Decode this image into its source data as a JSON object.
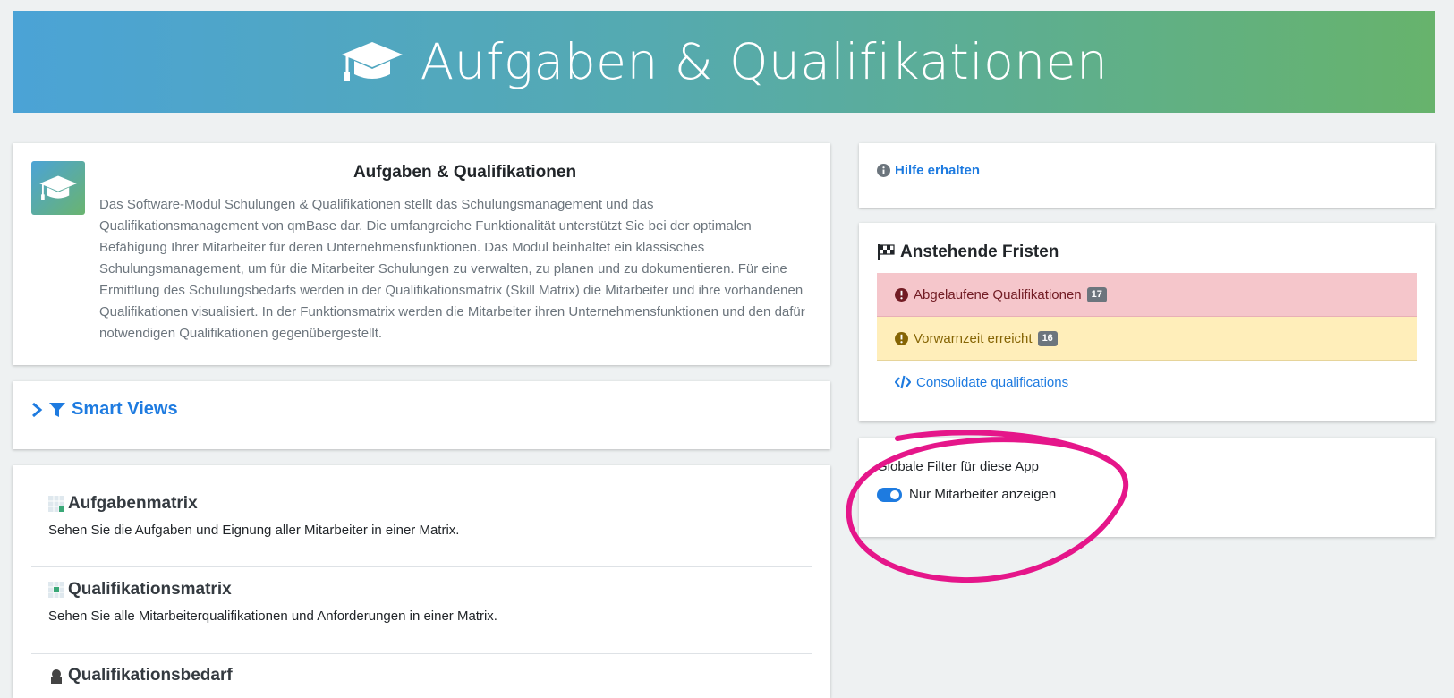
{
  "banner": {
    "title": "Aufgaben & Qualifikationen",
    "icon": "graduation-cap-icon"
  },
  "intro": {
    "icon": "graduation-cap-icon",
    "title": "Aufgaben & Qualifikationen",
    "text": "Das Software-Modul Schulungen & Qualifikationen stellt das Schulungsmanagement und das Qualifikationsmanagement von qmBase dar. Die umfangreiche Funktionalität unterstützt Sie bei der optimalen Befähigung Ihrer Mitarbeiter für deren Unternehmensfunktionen. Das Modul beinhaltet ein klassisches Schulungsmanagement, um für die Mitarbeiter Schulungen zu verwalten, zu planen und zu dokumentieren. Für eine Ermittlung des Schulungsbedarfs werden in der Qualifikationsmatrix (Skill Matrix) die Mitarbeiter und ihre vorhandenen Qualifikationen visualisiert. In der Funktionsmatrix werden die Mitarbeiter ihren Unternehmensfunktionen und den dafür notwendigen Qualifikationen gegenübergestellt."
  },
  "smart_views": {
    "label": "Smart Views"
  },
  "matrix": {
    "items": [
      {
        "title": "Aufgabenmatrix",
        "desc": "Sehen Sie die Aufgaben und Eignung aller Mitarbeiter in einer Matrix."
      },
      {
        "title": "Qualifikationsmatrix",
        "desc": "Sehen Sie alle Mitarbeiterqualifikationen und Anforderungen in einer Matrix."
      },
      {
        "title": "Qualifikationsbedarf"
      }
    ]
  },
  "help": {
    "label": "Hilfe erhalten"
  },
  "deadlines": {
    "title": "Anstehende Fristen",
    "expired": {
      "label": "Abgelaufene Qualifikationen",
      "count": "17"
    },
    "warning": {
      "label": "Vorwarnzeit erreicht",
      "count": "16"
    },
    "consolidate": {
      "label": "Consolidate qualifications"
    }
  },
  "filter": {
    "label": "Globale Filter für diese App",
    "toggle_label": "Nur Mitarbeiter anzeigen",
    "toggle_on": true
  },
  "colors": {
    "link": "#1e7be0",
    "annotation": "#e5168a",
    "danger_bg": "#f5c6cb",
    "warning_bg": "#ffeeba"
  }
}
